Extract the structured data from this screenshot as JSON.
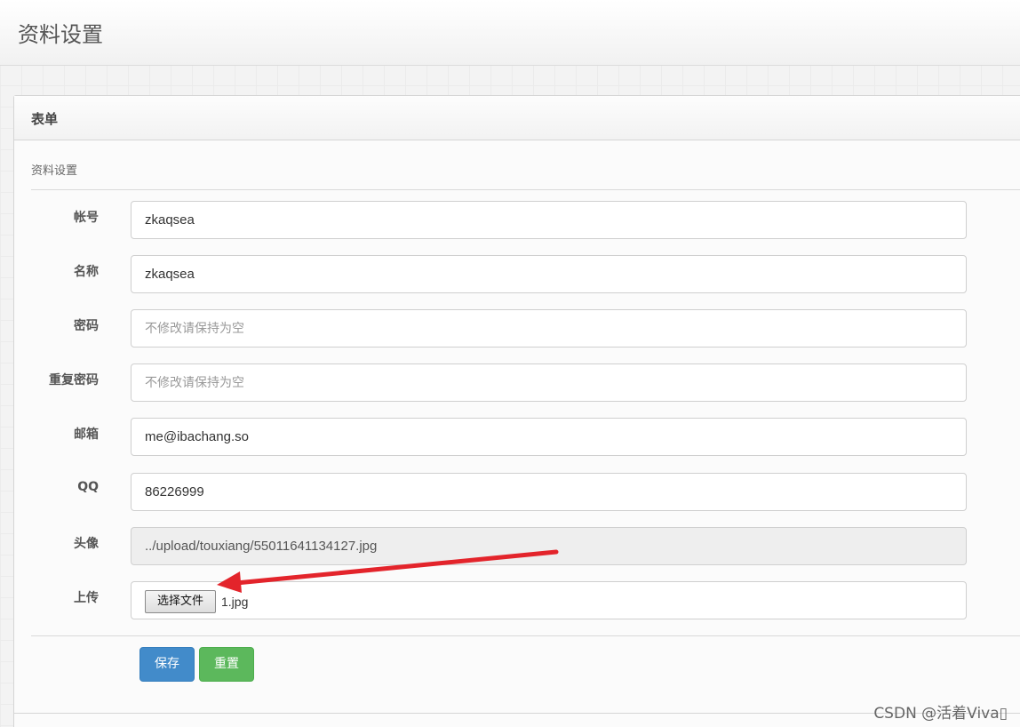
{
  "page": {
    "title": "资料设置"
  },
  "panel": {
    "title": "表单",
    "legend": "资料设置"
  },
  "fields": [
    {
      "label": "帐号",
      "value": "zkaqsea",
      "placeholder": ""
    },
    {
      "label": "名称",
      "value": "zkaqsea",
      "placeholder": ""
    },
    {
      "label": "密码",
      "value": "",
      "placeholder": "不修改请保持为空"
    },
    {
      "label": "重复密码",
      "value": "",
      "placeholder": "不修改请保持为空"
    },
    {
      "label": "邮箱",
      "value": "me@ibachang.so",
      "placeholder": ""
    },
    {
      "label": "QQ",
      "value": "86226999",
      "placeholder": ""
    },
    {
      "label": "头像",
      "value": "../upload/touxiang/55011641134127.jpg",
      "placeholder": ""
    }
  ],
  "upload": {
    "label": "上传",
    "button": "选择文件",
    "filename": "1.jpg"
  },
  "actions": {
    "save": "保存",
    "reset": "重置"
  },
  "annotation": {
    "color": "#e3242b"
  },
  "watermark": "CSDN @活着Viva▯"
}
